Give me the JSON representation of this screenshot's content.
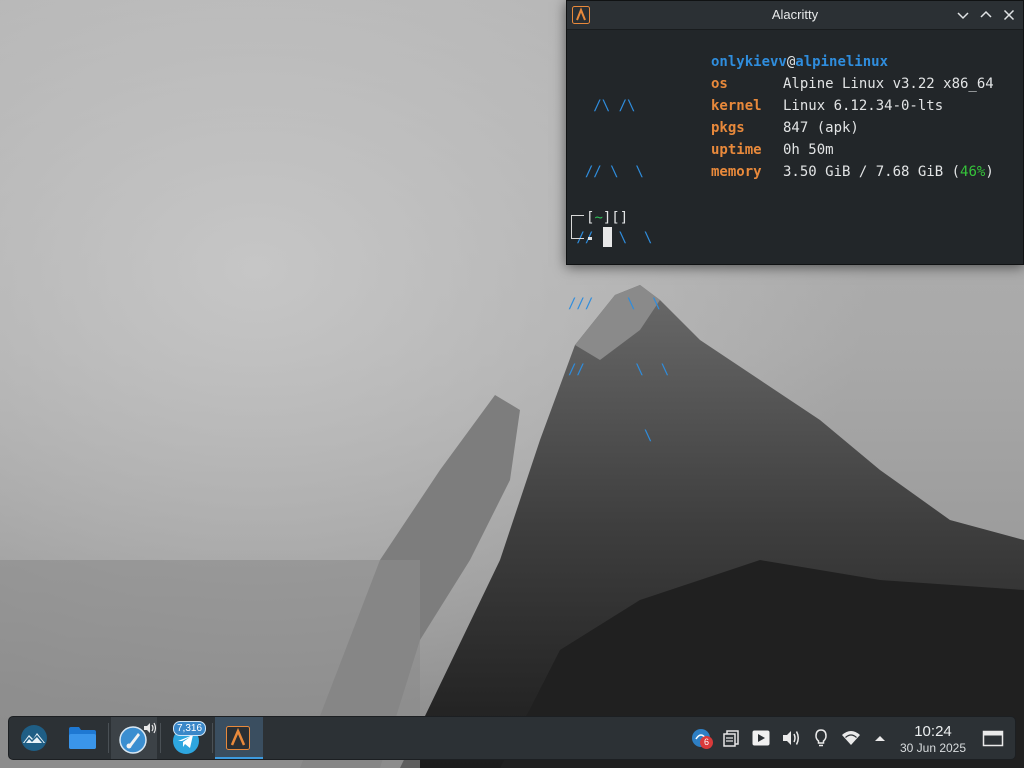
{
  "window": {
    "title": "Alacritty",
    "app_icon": "alacritty-icon"
  },
  "neofetch": {
    "logo_lines": [
      "   /\\ /\\",
      "  // \\  \\",
      " //   \\  \\",
      "///    \\  \\",
      "//      \\  \\",
      "         \\"
    ],
    "user": "onlykievv",
    "at": "@",
    "host": "alpinelinux",
    "rows": [
      {
        "key": "os",
        "value": "Alpine Linux v3.22 x86_64"
      },
      {
        "key": "kernel",
        "value": "Linux 6.12.34-0-lts"
      },
      {
        "key": "pkgs",
        "value": "847 (apk)"
      },
      {
        "key": "uptime",
        "value": "0h 50m"
      }
    ],
    "memory_key": "memory",
    "memory_value": "3.50 GiB / 7.68 GiB (",
    "memory_pct": "46%",
    "memory_close": ")"
  },
  "prompt": {
    "open": "[",
    "dir": "~",
    "close": "][]"
  },
  "taskbar": {
    "launchers": [
      {
        "name": "application-launcher",
        "icon": "alpine-mountain-icon"
      },
      {
        "name": "file-manager",
        "icon": "folder-icon"
      },
      {
        "name": "media-player",
        "icon": "quod-libet-icon"
      },
      {
        "name": "telegram",
        "icon": "telegram-icon"
      },
      {
        "name": "alacritty",
        "icon": "alacritty-icon"
      }
    ],
    "telegram_badge": "7,316",
    "notification_count": "6",
    "clock_time": "10:24",
    "clock_date": "30 Jun 2025"
  },
  "colors": {
    "accent": "#3d9be0",
    "logo_blue": "#2f8ddd",
    "key_orange": "#e8893b",
    "percent_green": "#35c43a"
  }
}
